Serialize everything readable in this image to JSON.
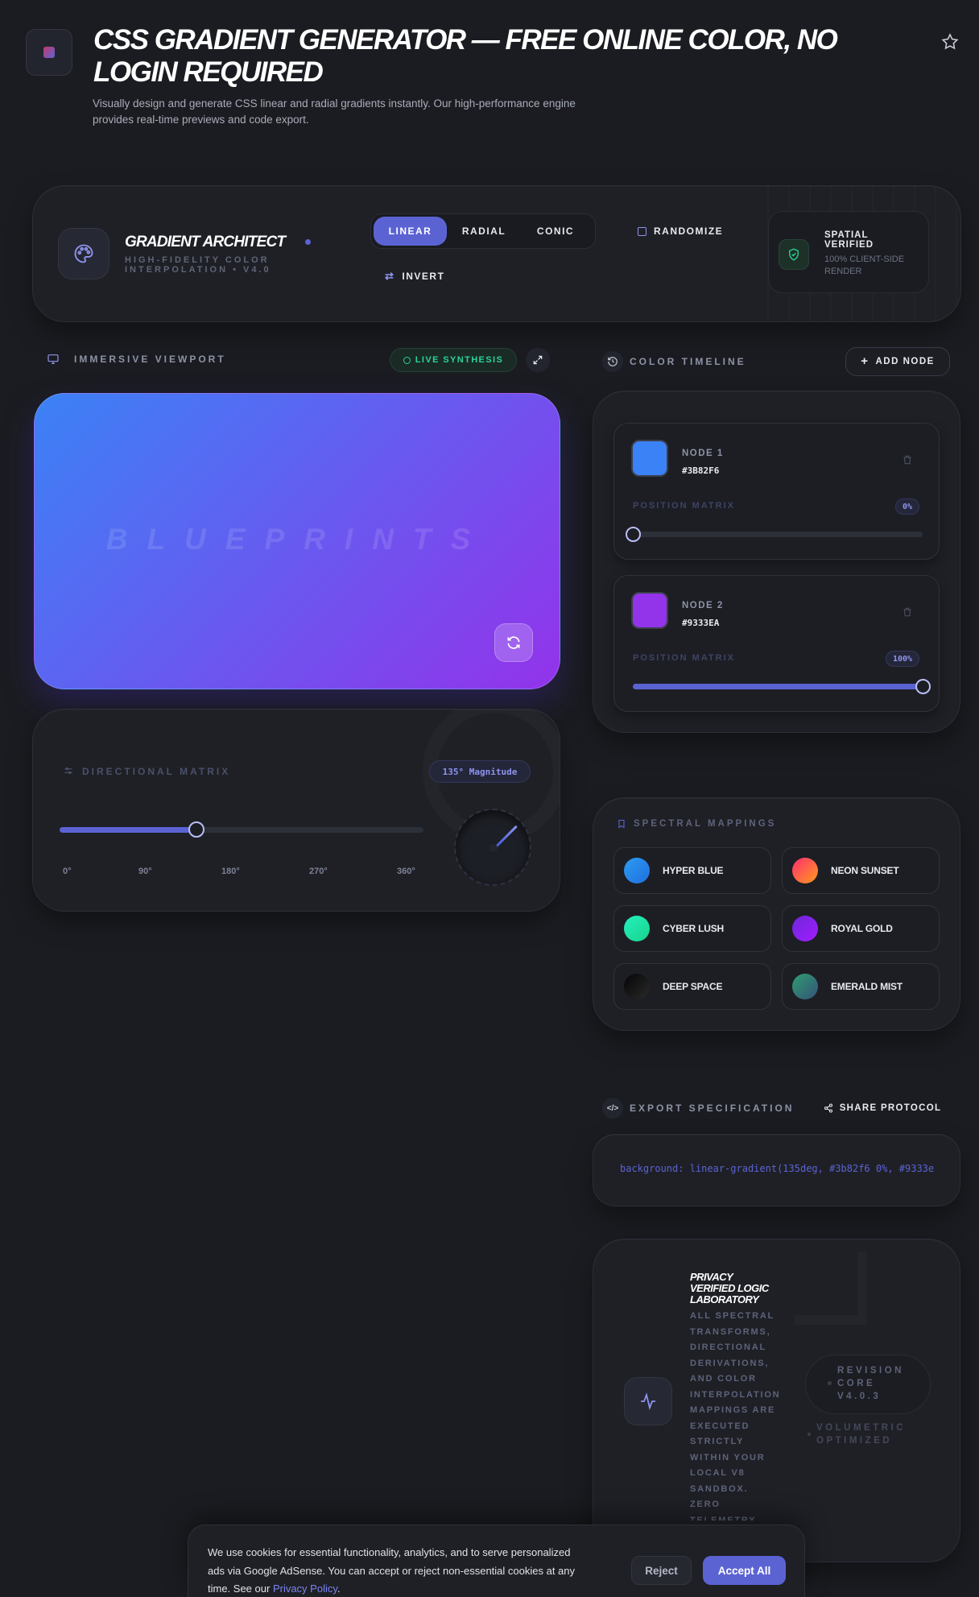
{
  "header": {
    "title_line1": "CSS GRADIENT GENERATOR — FREE ONLINE COLOR, NO",
    "title_line2": "LOGIN REQUIRED",
    "subtitle_line1": "Visually design and generate CSS linear and radial gradients instantly. Our high-performance engine",
    "subtitle_line2": "provides real-time previews and code export."
  },
  "toolbar": {
    "brand_title": "GRADIENT ARCHITECT",
    "brand_sub_line1": "HIGH-FIDELITY COLOR",
    "brand_sub_line2": "INTERPOLATION • V4.0",
    "modes": [
      {
        "label": "LINEAR",
        "active": true
      },
      {
        "label": "RADIAL",
        "active": false
      },
      {
        "label": "CONIC",
        "active": false
      }
    ],
    "randomize_label": "RANDOMIZE",
    "invert_label": "INVERT",
    "badge_title_line1": "SPATIAL",
    "badge_title_line2": "VERIFIED",
    "badge_sub_line1": "100% CLIENT-SIDE",
    "badge_sub_line2": "RENDER"
  },
  "viewport": {
    "label": "IMMERSIVE VIEWPORT",
    "live_label": "LIVE SYNTHESIS",
    "watermark": "BLUEPRINTS"
  },
  "direction": {
    "label": "DIRECTIONAL MATRIX",
    "magnitude": "135° Magnitude",
    "angle": 135,
    "max": 360,
    "ticks": [
      "0°",
      "90°",
      "180°",
      "270°",
      "360°"
    ]
  },
  "timeline": {
    "label": "COLOR TIMELINE",
    "add_label": "ADD NODE",
    "position_label": "POSITION MATRIX",
    "nodes": [
      {
        "name": "NODE 1",
        "hex": "#3B82F6",
        "position": "0%",
        "value": 0,
        "color": "#3b82f6"
      },
      {
        "name": "NODE 2",
        "hex": "#9333EA",
        "position": "100%",
        "value": 100,
        "color": "#9333ea"
      }
    ]
  },
  "spectral": {
    "label": "SPECTRAL MAPPINGS",
    "presets": [
      {
        "name": "HYPER BLUE",
        "from": "#2d9cf0",
        "to": "#1f6fe0"
      },
      {
        "name": "NEON SUNSET",
        "from": "#ff2e6e",
        "to": "#ff9a1f"
      },
      {
        "name": "CYBER LUSH",
        "from": "#23f0c0",
        "to": "#1ad28a"
      },
      {
        "name": "ROYAL GOLD",
        "from": "#6d28d9",
        "to": "#a21cff"
      },
      {
        "name": "DEEP SPACE",
        "from": "#050505",
        "to": "#2a2a2a"
      },
      {
        "name": "EMERALD MIST",
        "from": "#2f9e6f",
        "to": "#34517a"
      }
    ]
  },
  "export": {
    "label": "EXPORT SPECIFICATION",
    "share_label": "SHARE PROTOCOL",
    "code": "background: linear-gradient(135deg, #3b82f6 0%, #9333e"
  },
  "privacy": {
    "title_line1": "PRIVACY",
    "title_line2": "VERIFIED LOGIC",
    "title_line3": "LABORATORY",
    "body_lines": [
      "ALL SPECTRAL",
      "TRANSFORMS,",
      "DIRECTIONAL",
      "DERIVATIONS,",
      "AND COLOR",
      "INTERPOLATION",
      "MAPPINGS ARE",
      "EXECUTED",
      "STRICTLY",
      "WITHIN YOUR",
      "LOCAL V8",
      "SANDBOX.",
      "ZERO",
      "TELEMETRY"
    ],
    "revision_line1": "REVISION",
    "revision_line2": "CORE",
    "revision_line3": "V4.0.3",
    "volumetric_line1": "VOLUMETRIC",
    "volumetric_line2": "OPTIMIZED"
  },
  "cookie": {
    "line1": "We use cookies for essential functionality, analytics, and to serve personalized",
    "line2": "ads via Google AdSense. You can accept or reject non-essential cookies at any",
    "line3_prefix": "time. See our ",
    "link": "Privacy Policy",
    "line3_suffix": ".",
    "reject": "Reject",
    "accept": "Accept All"
  },
  "colors": {
    "accent": "#5b63d3",
    "live_green": "#2bd39a",
    "gradient_start": "#3b82f6",
    "gradient_end": "#9333ea"
  }
}
